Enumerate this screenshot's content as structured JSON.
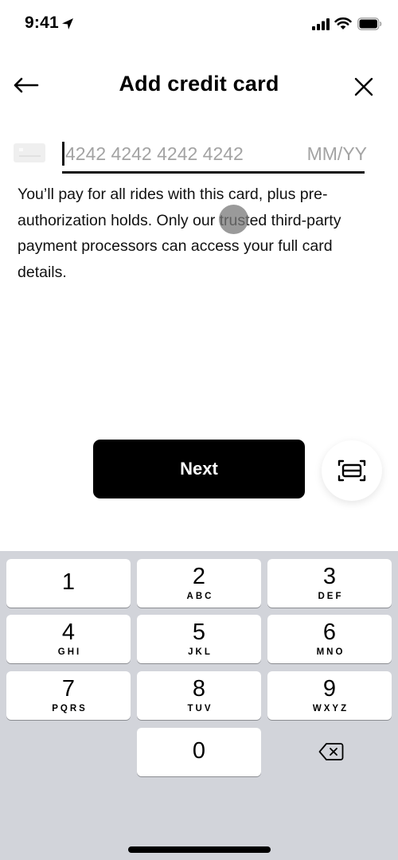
{
  "status_bar": {
    "time": "9:41",
    "icons": [
      "location-arrow-icon",
      "cellular-signal-icon",
      "wifi-icon",
      "battery-icon"
    ]
  },
  "header": {
    "title": "Add credit card",
    "back_icon": "arrow-left-icon",
    "close_icon": "close-icon"
  },
  "card_form": {
    "card_icon": "credit-card-icon",
    "card_number_value": "",
    "card_number_placeholder": "4242 4242 4242 4242",
    "expiry_value": "",
    "expiry_placeholder": "MM/YY"
  },
  "description": "You’ll pay for all rides with this card, plus pre-authorization holds. Only our trusted third-party payment processors can access your full card details.",
  "actions": {
    "next_label": "Next",
    "scan_icon": "scan-card-icon"
  },
  "keyboard": {
    "keys": [
      {
        "digit": "1",
        "letters": ""
      },
      {
        "digit": "2",
        "letters": "ABC"
      },
      {
        "digit": "3",
        "letters": "DEF"
      },
      {
        "digit": "4",
        "letters": "GHI"
      },
      {
        "digit": "5",
        "letters": "JKL"
      },
      {
        "digit": "6",
        "letters": "MNO"
      },
      {
        "digit": "7",
        "letters": "PQRS"
      },
      {
        "digit": "8",
        "letters": "TUV"
      },
      {
        "digit": "9",
        "letters": "WXYZ"
      },
      {
        "digit": "0",
        "letters": ""
      }
    ],
    "delete_icon": "backspace-icon"
  },
  "colors": {
    "primary_button": "#000000",
    "keyboard_background": "#d2d4da",
    "placeholder": "#a3a3a3"
  }
}
